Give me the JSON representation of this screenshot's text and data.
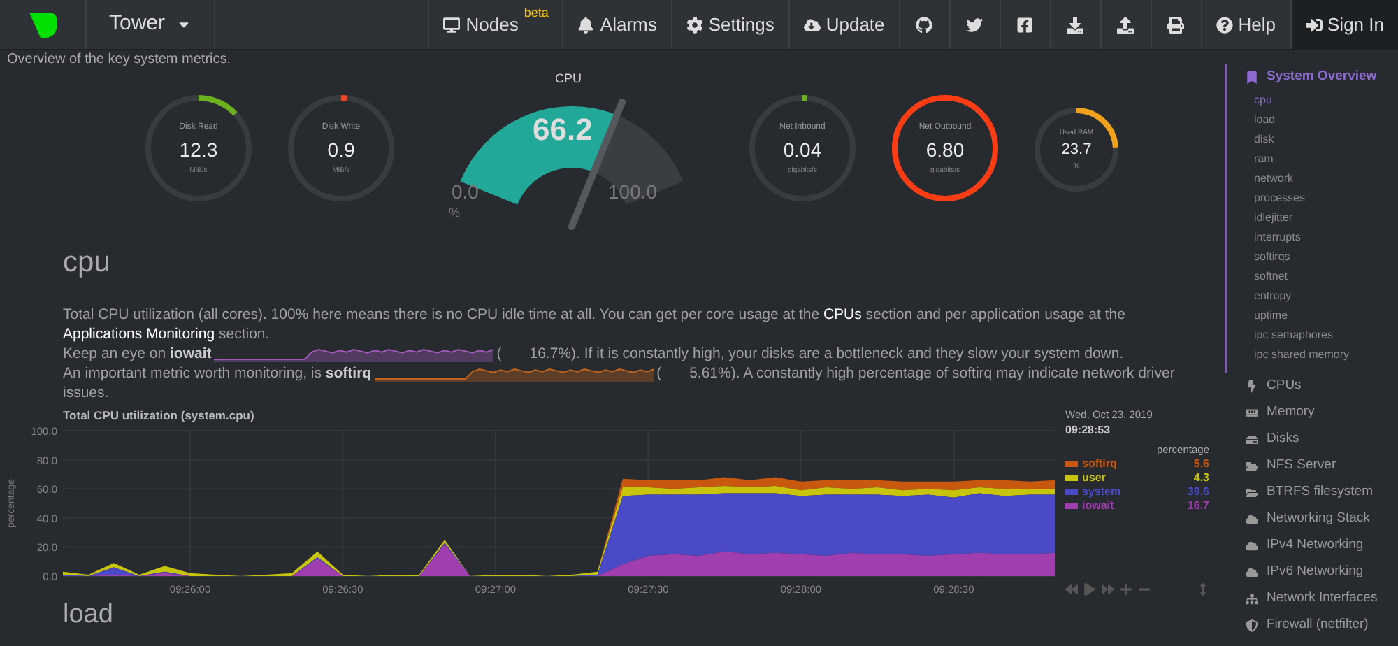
{
  "topbar": {
    "host": "Tower",
    "nav": [
      {
        "label": "Nodes",
        "badge": "beta"
      },
      {
        "label": "Alarms"
      },
      {
        "label": "Settings"
      },
      {
        "label": "Update"
      }
    ],
    "right": [
      {
        "label": "Help"
      },
      {
        "label": "Sign In"
      }
    ]
  },
  "intro": "Overview of the key system metrics.",
  "gauges": [
    {
      "kind": "ring",
      "title": "Disk Read",
      "value": "12.3",
      "unit": "MiB/s",
      "level": 0.13,
      "color": "#6db01f"
    },
    {
      "kind": "ring",
      "title": "Disk Write",
      "value": "0.9",
      "unit": "MiB/s",
      "level": 0.02,
      "color": "#e8452a"
    },
    {
      "kind": "dial",
      "title": "CPU",
      "value": "66.2",
      "min": "0.0",
      "max": "100.0",
      "unit": "%",
      "color": "#22a899"
    },
    {
      "kind": "ring",
      "title": "Net Inbound",
      "value": "0.04",
      "unit": "gigabits/s",
      "level": 0.015,
      "color": "#6db01f"
    },
    {
      "kind": "ring",
      "title": "Net Outbound",
      "value": "6.80",
      "unit": "gigabits/s",
      "level": 1,
      "color": "#ff3d14"
    },
    {
      "kind": "small_ring",
      "title": "Used RAM",
      "value": "23.7",
      "unit": "%",
      "level": 0.24,
      "color": "#f2a11d"
    }
  ],
  "section": {
    "heading": "cpu",
    "paragraphs": [
      {
        "parts": [
          {
            "kind": "text",
            "text": "Total CPU utilization (all cores). 100% here means there is no CPU idle time at all. You can get per core usage at the "
          },
          {
            "kind": "link",
            "text": "CPUs"
          },
          {
            "kind": "text",
            "text": " section and per application usage at the "
          },
          {
            "kind": "link",
            "text": "Applications Monitoring"
          },
          {
            "kind": "text",
            "text": " section."
          }
        ]
      },
      {
        "parts": [
          {
            "kind": "text",
            "text": "Keep an eye on "
          },
          {
            "kind": "bold",
            "text": "iowait"
          },
          {
            "kind": "sparkline",
            "color": "#a15cb9"
          },
          {
            "kind": "text",
            "text": "("
          },
          {
            "kind": "value",
            "text": "16.7%"
          },
          {
            "kind": "text",
            "text": "). If it is constantly high, your disks are a bottleneck and they slow your system down."
          }
        ]
      },
      {
        "parts": [
          {
            "kind": "text",
            "text": "An important metric worth monitoring, is "
          },
          {
            "kind": "bold",
            "text": "softirq"
          },
          {
            "kind": "sparkline",
            "color": "#c0631c"
          },
          {
            "kind": "text",
            "text": "("
          },
          {
            "kind": "value",
            "text": "5.61%"
          },
          {
            "kind": "text",
            "text": "). A constantly high percentage of softirq may indicate network driver issues."
          }
        ]
      }
    ],
    "chart_data": {
      "type": "area",
      "stacked": true,
      "title": "Total CPU utilization (system.cpu)",
      "ylabel": "percentage",
      "categories": [
        null,
        null,
        null,
        null,
        null,
        "09:26:00",
        null,
        null,
        null,
        null,
        null,
        "09:26:30",
        null,
        null,
        null,
        null,
        null,
        "09:27:00",
        null,
        null,
        null,
        null,
        null,
        "09:27:30",
        null,
        null,
        null,
        null,
        null,
        "09:28:00",
        null,
        null,
        null,
        null,
        null,
        "09:28:30",
        null,
        null,
        null,
        null
      ],
      "ylim": [
        0,
        100
      ],
      "grid": true,
      "yticks": [
        {
          "value": 0,
          "label": "0.0"
        },
        {
          "value": 20,
          "label": "20.0"
        },
        {
          "value": 40,
          "label": "40.0"
        },
        {
          "value": 60,
          "label": "60.0"
        },
        {
          "value": 80,
          "label": "80.0"
        },
        {
          "value": 100,
          "label": "100.0"
        }
      ],
      "series": [
        {
          "name": "softirq",
          "color": "#c9580f",
          "values": [
            0,
            0,
            0,
            0,
            0,
            0,
            0,
            0,
            0,
            0,
            0,
            0,
            0,
            0,
            0,
            0,
            0,
            0,
            0,
            0,
            0,
            0,
            6,
            5,
            6,
            5,
            6,
            5,
            6,
            6,
            5,
            6,
            5,
            6,
            5,
            6,
            5,
            6,
            5,
            6
          ]
        },
        {
          "name": "user",
          "color": "#c8c40c",
          "values": [
            2,
            1,
            3,
            1,
            4,
            2,
            1,
            0,
            1,
            2,
            4,
            1,
            0,
            1,
            1,
            2,
            0,
            1,
            1,
            0,
            1,
            2,
            6,
            5,
            4,
            5,
            5,
            4,
            5,
            4,
            5,
            4,
            5,
            4,
            4,
            5,
            4,
            5,
            4,
            4
          ]
        },
        {
          "name": "system",
          "color": "#4a4ac7",
          "values": [
            1,
            0,
            5,
            0,
            1,
            0,
            0,
            0,
            0,
            0,
            1,
            0,
            0,
            0,
            0,
            1,
            0,
            0,
            0,
            0,
            0,
            1,
            47,
            42,
            41,
            42,
            40,
            42,
            41,
            40,
            42,
            40,
            41,
            40,
            42,
            39,
            41,
            40,
            41,
            40
          ]
        },
        {
          "name": "iowait",
          "color": "#a03eb0",
          "values": [
            0,
            0,
            1,
            0,
            2,
            0,
            0,
            0,
            0,
            0,
            12,
            0,
            0,
            0,
            0,
            22,
            0,
            0,
            0,
            0,
            0,
            0,
            8,
            14,
            15,
            14,
            17,
            15,
            16,
            15,
            14,
            16,
            15,
            15,
            14,
            15,
            16,
            15,
            15,
            16
          ]
        }
      ]
    },
    "legend": {
      "date": "Wed, Oct 23, 2019",
      "time": "09:28:53",
      "units": "percentage",
      "values": [
        "5.6",
        "4.3",
        "39.6",
        "16.7"
      ]
    }
  },
  "next_heading": "load",
  "sidebar": [
    {
      "label": "System Overview",
      "selected": true,
      "children": [
        {
          "label": "cpu",
          "selected": true
        },
        {
          "label": "load",
          "selected": false
        },
        {
          "label": "disk",
          "selected": false
        },
        {
          "label": "ram",
          "selected": false
        },
        {
          "label": "network",
          "selected": false
        },
        {
          "label": "processes",
          "selected": false
        },
        {
          "label": "idlejitter",
          "selected": false
        },
        {
          "label": "interrupts",
          "selected": false
        },
        {
          "label": "softirqs",
          "selected": false
        },
        {
          "label": "softnet",
          "selected": false
        },
        {
          "label": "entropy",
          "selected": false
        },
        {
          "label": "uptime",
          "selected": false
        },
        {
          "label": "ipc semaphores",
          "selected": false
        },
        {
          "label": "ipc shared memory",
          "selected": false
        }
      ]
    },
    {
      "label": "CPUs",
      "selected": false
    },
    {
      "label": "Memory",
      "selected": false
    },
    {
      "label": "Disks",
      "selected": false
    },
    {
      "label": "NFS Server",
      "selected": false
    },
    {
      "label": "BTRFS filesystem",
      "selected": false
    },
    {
      "label": "Networking Stack",
      "selected": false
    },
    {
      "label": "IPv4 Networking",
      "selected": false
    },
    {
      "label": "IPv6 Networking",
      "selected": false
    },
    {
      "label": "Network Interfaces",
      "selected": false
    },
    {
      "label": "Firewall (netfilter)",
      "selected": false
    }
  ]
}
